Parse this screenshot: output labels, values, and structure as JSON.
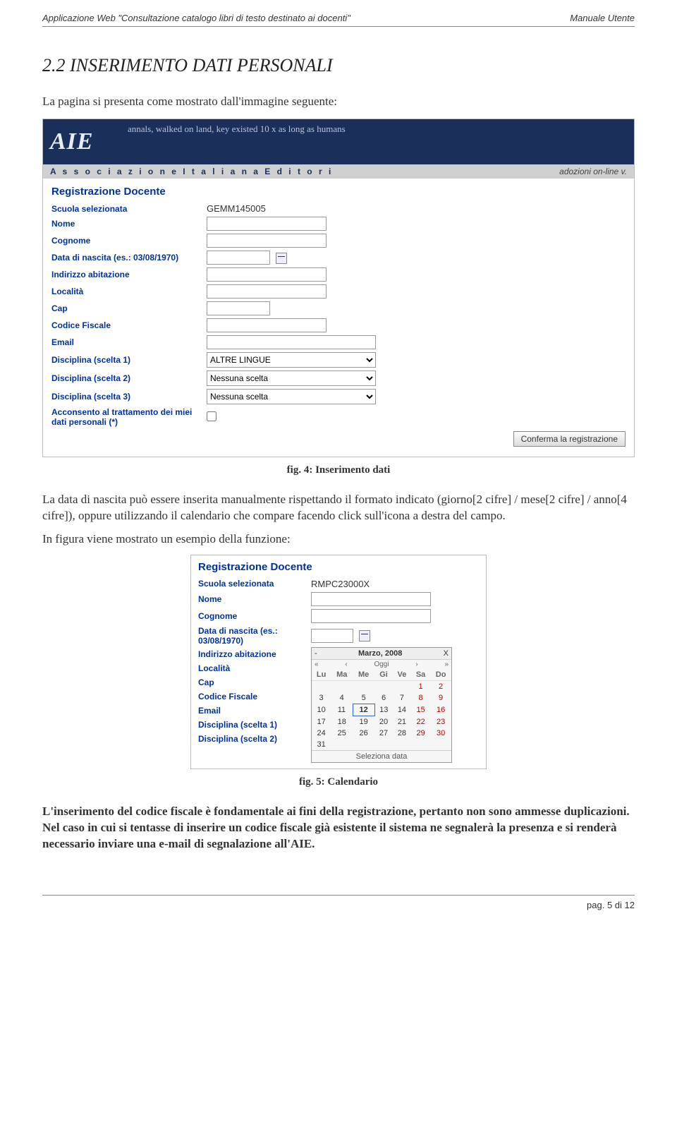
{
  "header": {
    "left": "Applicazione Web \"Consultazione catalogo libri di testo destinato ai docenti\"",
    "right": "Manuale Utente"
  },
  "section_title": "2.2   INSERIMENTO DATI PERSONALI",
  "intro": "La pagina si presenta come mostrato dall'immagine seguente:",
  "banner": {
    "logo": "AIE",
    "script": "annals, walked on land, key existed 10 x as long as humans",
    "assoc": "A s s o c i a z i o n e    I t a l i a n a    E d i t o r i",
    "adoz": "adozioni on-line   v."
  },
  "form1": {
    "title": "Registrazione Docente",
    "rows": {
      "scuola_label": "Scuola selezionata",
      "scuola_value": "GEMM145005",
      "nome": "Nome",
      "cognome": "Cognome",
      "data": "Data di nascita (es.: 03/08/1970)",
      "indirizzo": "Indirizzo abitazione",
      "localita": "Località",
      "cap": "Cap",
      "cf": "Codice Fiscale",
      "email": "Email",
      "disc1": "Disciplina (scelta 1)",
      "disc1_val": "ALTRE LINGUE",
      "disc2": "Disciplina (scelta 2)",
      "disc2_val": "Nessuna scelta",
      "disc3": "Disciplina (scelta 3)",
      "disc3_val": "Nessuna scelta",
      "consent": "Acconsento al trattamento dei miei dati personali (*)",
      "confirm": "Conferma la registrazione"
    }
  },
  "caption1": "fig. 4: Inserimento dati",
  "body1": "La data di nascita può essere inserita manualmente rispettando il formato indicato (giorno[2 cifre] / mese[2 cifre] / anno[4 cifre]), oppure utilizzando il calendario che compare facendo click sull'icona a destra del campo.",
  "body2": "In figura  viene mostrato un esempio della funzione:",
  "form2": {
    "title": "Registrazione Docente",
    "scuola_label": "Scuola selezionata",
    "scuola_value": "RMPC23000X",
    "nome": "Nome",
    "cognome": "Cognome",
    "data": "Data di nascita (es.: 03/08/1970)",
    "indirizzo": "Indirizzo abitazione",
    "localita": "Località",
    "cap": "Cap",
    "cf": "Codice Fiscale",
    "email": "Email",
    "disc1": "Disciplina (scelta 1)",
    "disc2": "Disciplina (scelta 2)"
  },
  "calendar": {
    "month": "Marzo, 2008",
    "close": "X",
    "back": "-",
    "prev2": "«",
    "prev1": "‹",
    "today": "Oggi",
    "next1": "›",
    "next2": "»",
    "days": [
      "Lu",
      "Ma",
      "Me",
      "Gi",
      "Ve",
      "Sa",
      "Do"
    ],
    "weeks": [
      [
        "",
        "",
        "",
        "",
        "",
        "1",
        "2"
      ],
      [
        "3",
        "4",
        "5",
        "6",
        "7",
        "8",
        "9"
      ],
      [
        "10",
        "11",
        "12",
        "13",
        "14",
        "15",
        "16"
      ],
      [
        "17",
        "18",
        "19",
        "20",
        "21",
        "22",
        "23"
      ],
      [
        "24",
        "25",
        "26",
        "27",
        "28",
        "29",
        "30"
      ],
      [
        "31",
        "",
        "",
        "",
        "",
        "",
        ""
      ]
    ],
    "selected": "12",
    "footer": "Seleziona data"
  },
  "caption2": "fig. 5: Calendario",
  "body3": "L'inserimento del codice fiscale è fondamentale ai fini della registrazione, pertanto non sono ammesse duplicazioni. Nel caso in cui si tentasse di inserire un codice fiscale già esistente il sistema ne segnalerà la presenza e si renderà necessario inviare una e-mail di segnalazione all'AIE.",
  "footer": "pag. 5 di 12"
}
